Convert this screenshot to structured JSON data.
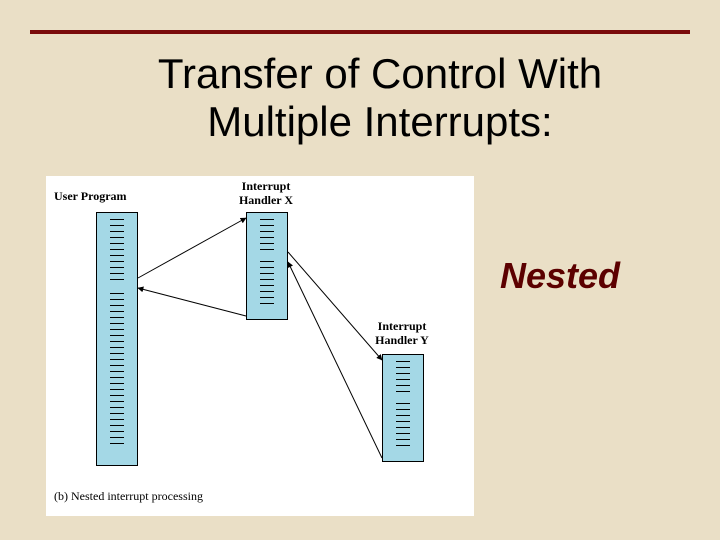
{
  "title_line1": "Transfer of Control With",
  "title_line2": "Multiple Interrupts:",
  "nested_label": "Nested",
  "diagram": {
    "labels": {
      "user_program": "User Program",
      "handler_x_line1": "Interrupt",
      "handler_x_line2": "Handler X",
      "handler_y_line1": "Interrupt",
      "handler_y_line2": "Handler Y"
    },
    "caption": "(b) Nested interrupt processing"
  }
}
